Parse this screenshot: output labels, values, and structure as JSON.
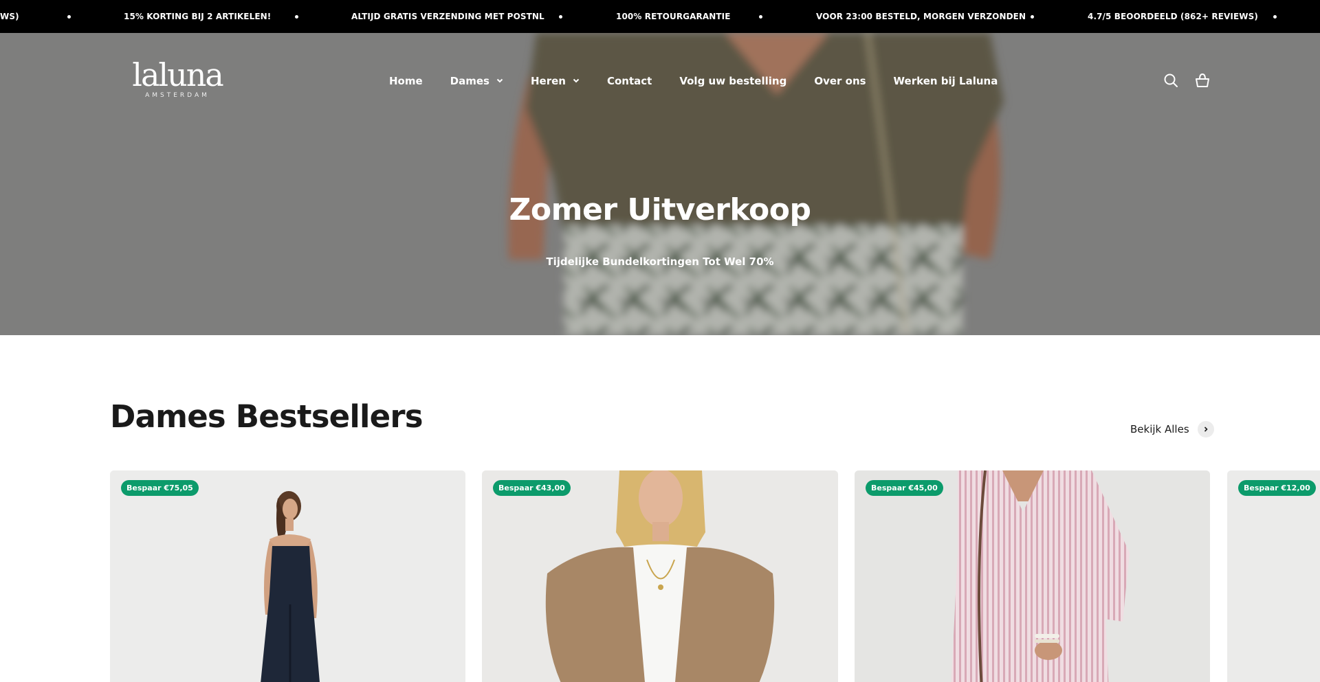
{
  "announcement": {
    "items": [
      "WS)",
      "15% KORTING BIJ 2 ARTIKELEN!",
      "ALTIJD GRATIS VERZENDING MET POSTNL",
      "100% RETOURGARANTIE",
      "VOOR 23:00 BESTELD, MORGEN VERZONDEN",
      "4.7/5 BEOORDEELD (862+ REVIEWS)"
    ]
  },
  "header": {
    "logo_word": "laluna",
    "logo_sub": "AMSTERDAM",
    "nav": [
      {
        "label": "Home"
      },
      {
        "label": "Dames"
      },
      {
        "label": "Heren"
      },
      {
        "label": "Contact"
      },
      {
        "label": "Volg uw bestelling"
      },
      {
        "label": "Over ons"
      },
      {
        "label": "Werken bij Laluna"
      }
    ],
    "icons": [
      "search-icon",
      "cart-icon"
    ]
  },
  "hero": {
    "title": "Zomer Uitverkoop",
    "subtitle": "Tijdelijke Bundelkortingen Tot Wel 70%"
  },
  "bestsellers": {
    "title": "Dames Bestsellers",
    "view_all": "Bekijk Alles",
    "products": [
      {
        "badge": "Bespaar €75,05"
      },
      {
        "badge": "Bespaar €43,00"
      },
      {
        "badge": "Bespaar €45,00"
      },
      {
        "badge": "Bespaar €12,00"
      }
    ]
  },
  "colors": {
    "announcement_bg": "#000000",
    "badge": "#0c9b6b",
    "text": "#1a1a1a"
  }
}
